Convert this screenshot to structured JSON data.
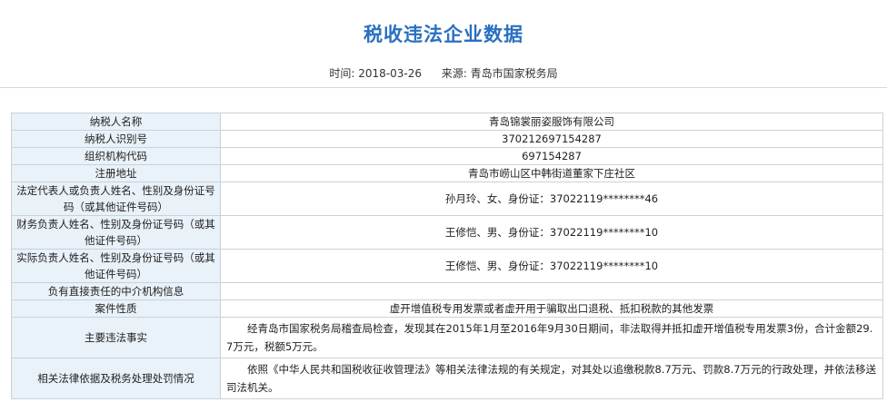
{
  "page": {
    "title": "税收违法企业数据",
    "time_label": "时间:",
    "time_value": "2018-03-26",
    "source_label": "来源:",
    "source_value": "青岛市国家税务局"
  },
  "rows": [
    {
      "label": "纳税人名称",
      "value": "青岛锦裳丽姿服饰有限公司"
    },
    {
      "label": "纳税人识别号",
      "value": "370212697154287"
    },
    {
      "label": "组织机构代码",
      "value": "697154287"
    },
    {
      "label": "注册地址",
      "value": "青岛市崂山区中韩街道董家下庄社区"
    },
    {
      "label": "法定代表人或负责人姓名、性别及身份证号码（或其他证件号码）",
      "value": "孙月玲、女、身份证：37022119********46"
    },
    {
      "label": "财务负责人姓名、性别及身份证号码（或其他证件号码）",
      "value": "王修恺、男、身份证：37022119********10"
    },
    {
      "label": "实际负责人姓名、性别及身份证号码（或其他证件号码）",
      "value": "王修恺、男、身份证：37022119********10"
    },
    {
      "label": "负有直接责任的中介机构信息",
      "value": ""
    },
    {
      "label": "案件性质",
      "value": "虚开增值税专用发票或者虚开用于骗取出口退税、抵扣税款的其他发票"
    },
    {
      "label": "主要违法事实",
      "value": "经青岛市国家税务局稽查局检查，发现其在2015年1月至2016年9月30日期间，非法取得并抵扣虚开增值税专用发票3份，合计金额29.7万元，税额5万元。"
    },
    {
      "label": "相关法律依据及税务处理处罚情况",
      "value": "依照《中华人民共和国税收征收管理法》等相关法律法规的有关规定，对其处以追缴税款8.7万元、罚款8.7万元的行政处理，并依法移送司法机关。"
    }
  ]
}
